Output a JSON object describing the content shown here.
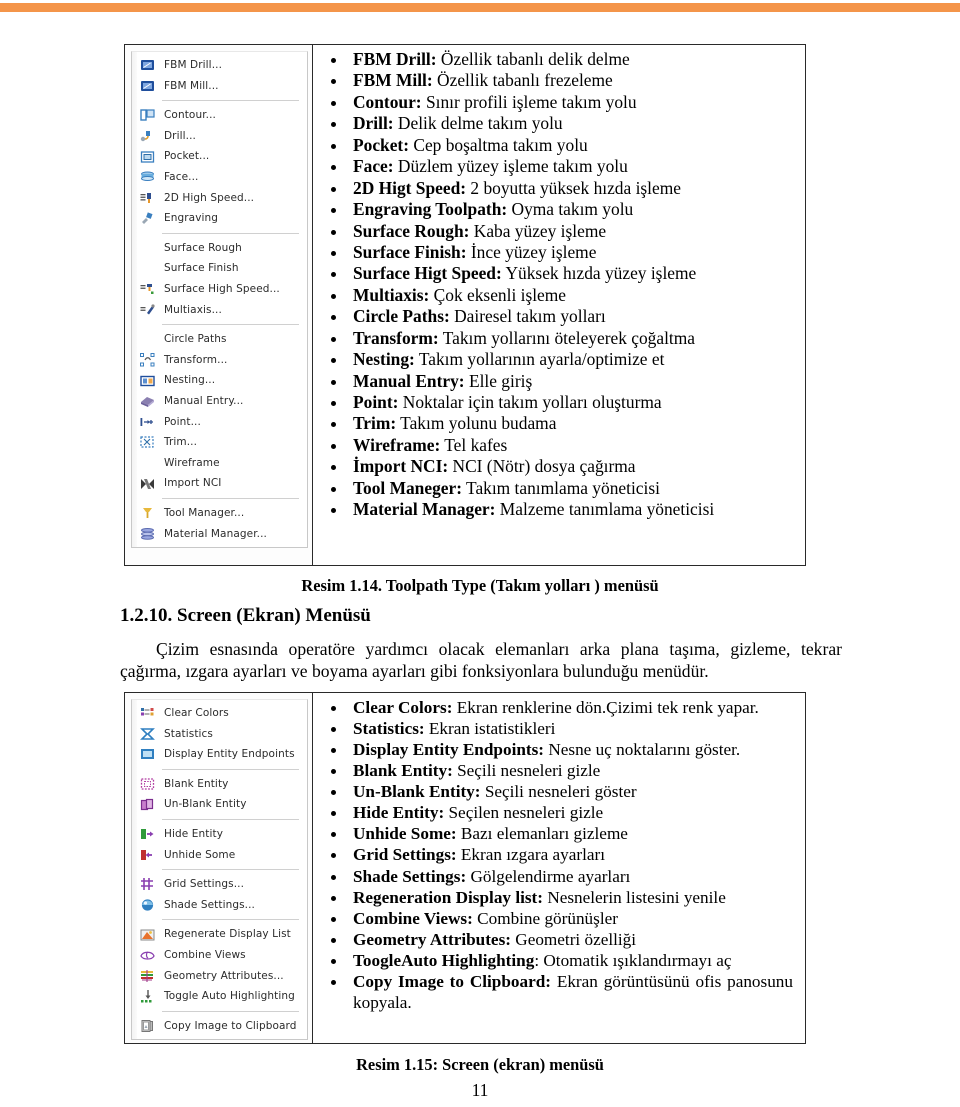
{
  "page": {
    "number": "11",
    "accent_color": "#F4954A"
  },
  "figure1": {
    "caption": "Resim 1.14. Toolpath Type (Takım yolları ) menüsü",
    "menu": {
      "name": "toolpath-type-menu",
      "groups": [
        {
          "items": [
            {
              "label": "FBM Drill...",
              "icon": "fbm-drill-icon"
            },
            {
              "label": "FBM Mill...",
              "icon": "fbm-mill-icon"
            }
          ]
        },
        {
          "items": [
            {
              "label": "Contour...",
              "icon": "contour-icon"
            },
            {
              "label": "Drill...",
              "icon": "drill-icon"
            },
            {
              "label": "Pocket...",
              "icon": "pocket-icon"
            },
            {
              "label": "Face...",
              "icon": "face-icon"
            },
            {
              "label": "2D High Speed...",
              "icon": "2d-high-speed-icon"
            },
            {
              "label": "Engraving",
              "icon": "engraving-icon"
            }
          ]
        },
        {
          "items": [
            {
              "label": "Surface Rough",
              "icon": "none"
            },
            {
              "label": "Surface Finish",
              "icon": "none"
            },
            {
              "label": "Surface High Speed...",
              "icon": "surface-high-speed-icon"
            },
            {
              "label": "Multiaxis...",
              "icon": "multiaxis-icon"
            }
          ]
        },
        {
          "items": [
            {
              "label": "Circle Paths",
              "icon": "none"
            },
            {
              "label": "Transform...",
              "icon": "transform-icon"
            },
            {
              "label": "Nesting...",
              "icon": "nesting-icon"
            },
            {
              "label": "Manual Entry...",
              "icon": "manual-entry-icon"
            },
            {
              "label": "Point...",
              "icon": "point-icon"
            },
            {
              "label": "Trim...",
              "icon": "trim-icon"
            },
            {
              "label": "Wireframe",
              "icon": "none"
            },
            {
              "label": "Import NCI",
              "icon": "import-nci-icon"
            }
          ]
        },
        {
          "items": [
            {
              "label": "Tool Manager...",
              "icon": "tool-manager-icon"
            },
            {
              "label": "Material Manager...",
              "icon": "material-manager-icon"
            }
          ]
        }
      ]
    },
    "descriptions": [
      {
        "term": "FBM Drill:",
        "desc": " Özellik tabanlı delik delme"
      },
      {
        "term": "FBM Mill:",
        "desc": " Özellik tabanlı frezeleme"
      },
      {
        "term": "Contour:",
        "desc": " Sınır profili işleme takım yolu"
      },
      {
        "term": "Drill:",
        "desc": " Delik delme takım yolu"
      },
      {
        "term": "Pocket:",
        "desc": " Cep boşaltma takım yolu"
      },
      {
        "term": "Face:",
        "desc": " Düzlem yüzey işleme takım yolu"
      },
      {
        "term": "2D Higt Speed:",
        "desc": " 2 boyutta yüksek hızda işleme"
      },
      {
        "term": "Engraving Toolpath:",
        "desc": " Oyma takım yolu"
      },
      {
        "term": "Surface Rough:",
        "desc": " Kaba yüzey işleme"
      },
      {
        "term": "Surface Finish:",
        "desc": " İnce yüzey işleme"
      },
      {
        "term": "Surface Higt Speed:",
        "desc": " Yüksek hızda yüzey işleme"
      },
      {
        "term": "Multiaxis:",
        "desc": " Çok eksenli işleme"
      },
      {
        "term": "Circle Paths:",
        "desc": " Dairesel takım yolları"
      },
      {
        "term": "Transform:",
        "desc": " Takım yollarını öteleyerek çoğaltma"
      },
      {
        "term": "Nesting:",
        "desc": " Takım yollarının ayarla/optimize et"
      },
      {
        "term": "Manual Entry:",
        "desc": " Elle giriş"
      },
      {
        "term": "Point:",
        "desc": " Noktalar için takım yolları oluşturma"
      },
      {
        "term": "Trim:",
        "desc": " Takım yolunu budama"
      },
      {
        "term": "Wireframe:",
        "desc": " Tel kafes"
      },
      {
        "term": "İmport NCI:",
        "desc": " NCI (Nötr) dosya çağırma"
      },
      {
        "term": "Tool Maneger:",
        "desc": " Takım tanımlama yöneticisi"
      },
      {
        "term": "Material Manager:",
        "desc": " Malzeme tanımlama yöneticisi"
      }
    ]
  },
  "section": {
    "heading": "1.2.10. Screen (Ekran) Menüsü",
    "paragraph": "Çizim esnasında operatöre yardımcı olacak elemanları arka plana taşıma, gizleme, tekrar çağırma, ızgara ayarları ve boyama ayarları gibi fonksiyonlara bulunduğu menüdür."
  },
  "figure2": {
    "caption": "Resim 1.15: Screen (ekran) menüsü",
    "menu": {
      "name": "screen-menu",
      "groups": [
        {
          "items": [
            {
              "label": "Clear Colors",
              "icon": "clear-colors-icon"
            },
            {
              "label": "Statistics",
              "icon": "statistics-icon"
            },
            {
              "label": "Display Entity Endpoints",
              "icon": "display-entity-endpoints-icon"
            }
          ]
        },
        {
          "items": [
            {
              "label": "Blank Entity",
              "icon": "blank-entity-icon"
            },
            {
              "label": "Un-Blank Entity",
              "icon": "un-blank-entity-icon"
            }
          ]
        },
        {
          "items": [
            {
              "label": "Hide Entity",
              "icon": "hide-entity-icon"
            },
            {
              "label": "Unhide Some",
              "icon": "unhide-some-icon"
            }
          ]
        },
        {
          "items": [
            {
              "label": "Grid Settings...",
              "icon": "grid-settings-icon"
            },
            {
              "label": "Shade Settings...",
              "icon": "shade-settings-icon"
            }
          ]
        },
        {
          "items": [
            {
              "label": "Regenerate Display List",
              "icon": "regenerate-display-list-icon"
            },
            {
              "label": "Combine Views",
              "icon": "combine-views-icon"
            },
            {
              "label": "Geometry Attributes...",
              "icon": "geometry-attributes-icon"
            },
            {
              "label": "Toggle Auto Highlighting",
              "icon": "toggle-auto-highlighting-icon"
            }
          ]
        },
        {
          "items": [
            {
              "label": "Copy Image to Clipboard",
              "icon": "copy-image-to-clipboard-icon"
            }
          ]
        }
      ]
    },
    "descriptions": [
      {
        "term": "Clear Colors:",
        "desc": " Ekran renklerine dön.Çizimi tek renk yapar."
      },
      {
        "term": "Statistics:",
        "desc": " Ekran istatistikleri"
      },
      {
        "term": "Display Entity Endpoints:",
        "desc": " Nesne uç noktalarını göster."
      },
      {
        "term": "Blank Entity:",
        "desc": " Seçili nesneleri gizle"
      },
      {
        "term": "Un-Blank Entity:",
        "desc": " Seçili nesneleri göster"
      },
      {
        "term": "Hide Entity:",
        "desc": " Seçilen nesneleri gizle"
      },
      {
        "term": "Unhide Some:",
        "desc": " Bazı elemanları gizleme"
      },
      {
        "term": "Grid Settings:",
        "desc": " Ekran ızgara ayarları"
      },
      {
        "term": "Shade Settings:",
        "desc": " Gölgelendirme ayarları"
      },
      {
        "term": "Regeneration Display list:",
        "desc": " Nesnelerin listesini yenile"
      },
      {
        "term": "Combine Views:",
        "desc": " Combine görünüşler"
      },
      {
        "term": "Geometry Attributes:",
        "desc": " Geometri özelliği"
      },
      {
        "term": "ToogleAuto Highlighting",
        "desc": ": Otomatik ışıklandırmayı aç"
      },
      {
        "term": "Copy Image to Clipboard:",
        "desc": " Ekran görüntüsünü ofis panosunu kopyala.",
        "wrap": true
      }
    ]
  }
}
